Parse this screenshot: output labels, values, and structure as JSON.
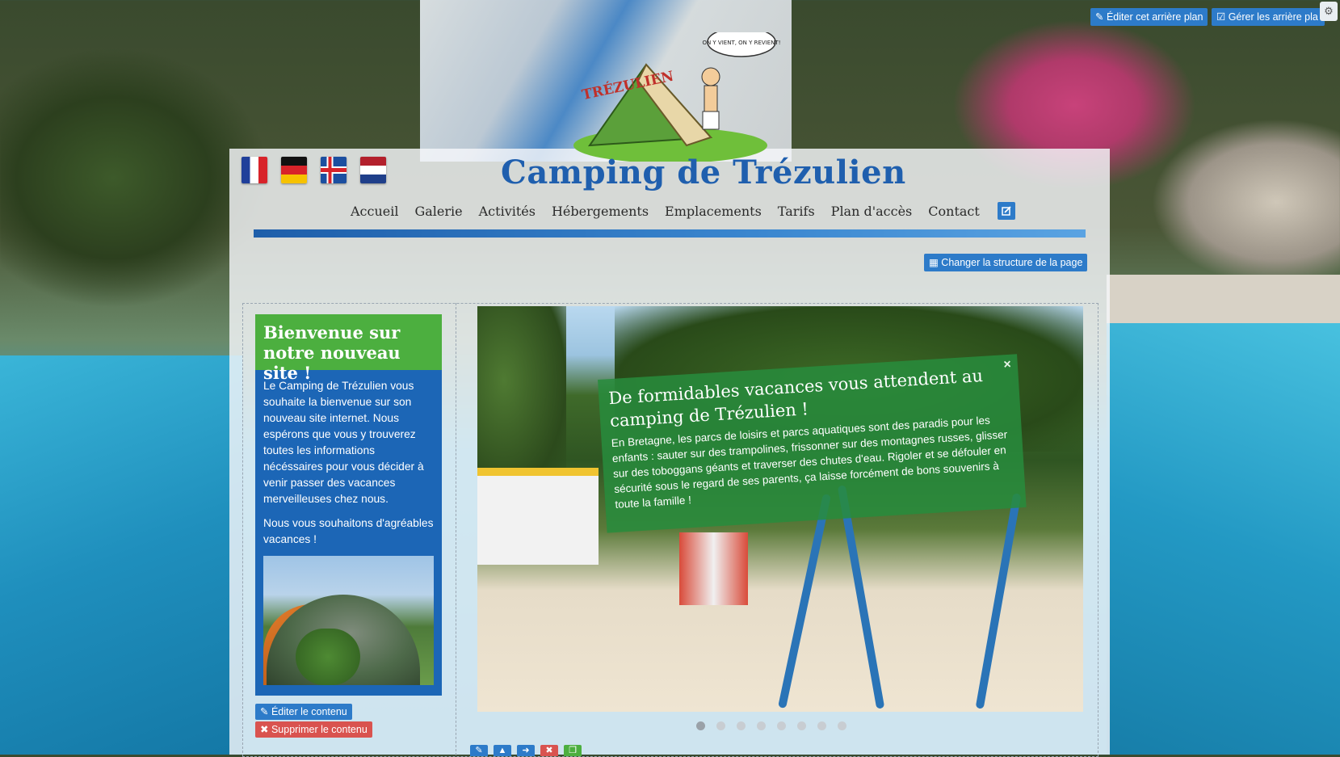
{
  "admin": {
    "edit_background": "Éditer cet arrière plan",
    "manage_backgrounds": "Gérer les arrière pla",
    "change_structure": "Changer la structure de la page",
    "edit_content": "Éditer le contenu",
    "delete_content": "Supprimer le contenu"
  },
  "logo": {
    "brand": "TRÉZULIEN",
    "bubble": "ON Y VIENT, ON Y REVIENT!"
  },
  "site": {
    "title": "Camping de Trézulien"
  },
  "languages": [
    "fr",
    "de",
    "is",
    "nl"
  ],
  "nav": {
    "items": [
      "Accueil",
      "Galerie",
      "Activités",
      "Hébergements",
      "Emplacements",
      "Tarifs",
      "Plan d'accès",
      "Contact"
    ]
  },
  "welcome": {
    "heading": "Bienvenue sur notre nouveau site !",
    "paragraph1": "Le Camping de Trézulien vous souhaite la bienvenue sur son nouveau site internet. Nous espérons que vous y trouverez toutes les informations nécéssaires pour vous décider à venir passer des vacances merveilleuses chez nous.",
    "paragraph2": "Nous vous souhaitons d'agréables vacances !"
  },
  "slider": {
    "title": "De formidables vacances vous attendent au camping de Trézulien !",
    "text": "En Bretagne, les parcs de loisirs et parcs aquatiques sont des paradis pour les enfants : sauter sur des trampolines, frissonner sur des montagnes russes, glisser sur des toboggans géants et traverser des chutes d'eau. Rigoler et se défouler en sécurité sous le regard de ses parents, ça laisse forcément de bons souvenirs à toute la famille !",
    "close": "×",
    "slide_count": 8,
    "active_index": 0
  },
  "colors": {
    "brand_blue": "#1f5fae",
    "admin_blue": "#2d7bc9",
    "welcome_green": "#4caf3f",
    "welcome_blue": "#1c66b6",
    "danger_red": "#d9534f"
  },
  "icons": {
    "edit": "pencil-icon",
    "manage": "edit-square-icon",
    "structure": "grid-icon",
    "delete": "close-icon"
  }
}
